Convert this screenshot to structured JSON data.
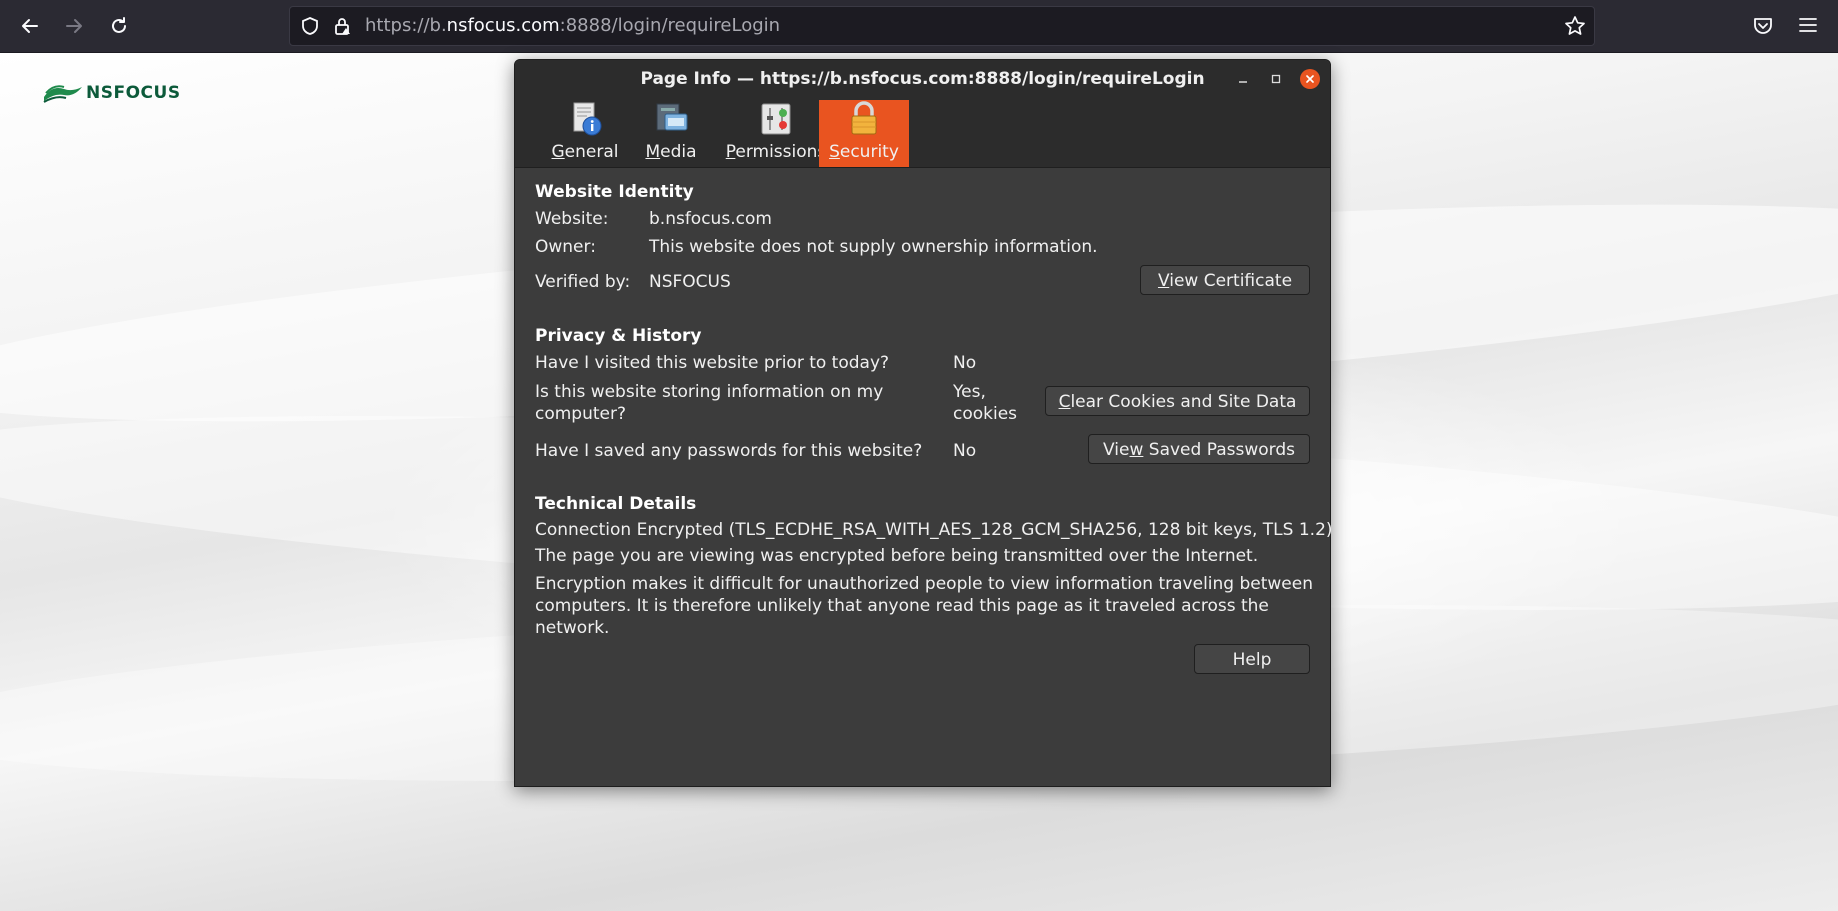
{
  "browser": {
    "url_prefix": "https://b.",
    "url_host": "nsfocus.com",
    "url_suffix": ":8888/login/requireLogin",
    "icons": [
      "back-icon",
      "forward-icon",
      "reload-icon",
      "shield-icon",
      "lock-icon",
      "bookmark-star-icon",
      "pocket-icon",
      "menu-icon"
    ]
  },
  "page": {
    "logo_text": "NSFOCUS"
  },
  "dialog": {
    "title": "Page Info — https://b.nsfocus.com:8888/login/requireLogin",
    "tabs": [
      {
        "key": "G",
        "rest": "eneral",
        "icon": "general-info-icon"
      },
      {
        "key": "M",
        "rest": "edia",
        "icon": "media-icon"
      },
      {
        "key": "P",
        "rest": "ermissions",
        "icon": "permissions-icon"
      },
      {
        "key": "S",
        "rest": "ecurity",
        "icon": "security-lock-icon",
        "active": true
      }
    ],
    "identity": {
      "heading": "Website Identity",
      "website_label": "Website:",
      "website_value": "b.nsfocus.com",
      "owner_label": "Owner:",
      "owner_value": "This website does not supply ownership information.",
      "verified_label": "Verified by:",
      "verified_value": "NSFOCUS",
      "view_cert_key": "V",
      "view_cert_rest": "iew Certificate"
    },
    "privacy": {
      "heading": "Privacy & History",
      "visited_q": "Have I visited this website prior to today?",
      "visited_a": "No",
      "storing_q": "Is this website storing information on my computer?",
      "storing_a": "Yes, cookies",
      "clear_key": "C",
      "clear_rest": "lear Cookies and Site Data",
      "passwords_q": "Have I saved any passwords for this website?",
      "passwords_a": "No",
      "view_pw_pre": "Vie",
      "view_pw_key": "w",
      "view_pw_rest": " Saved Passwords"
    },
    "technical": {
      "heading": "Technical Details",
      "connection": "Connection Encrypted (TLS_ECDHE_RSA_WITH_AES_128_GCM_SHA256, 128 bit keys, TLS 1.2)",
      "line1": "The page you are viewing was encrypted before being transmitted over the Internet.",
      "line2": "Encryption makes it difficult for unauthorized people to view information traveling between computers. It is therefore unlikely that anyone read this page as it traveled across the network."
    },
    "help_label": "Help"
  },
  "colors": {
    "accent": "#e95420",
    "dialog_bg": "#3c3c3c",
    "toolbar_bg": "#2b2a33"
  }
}
